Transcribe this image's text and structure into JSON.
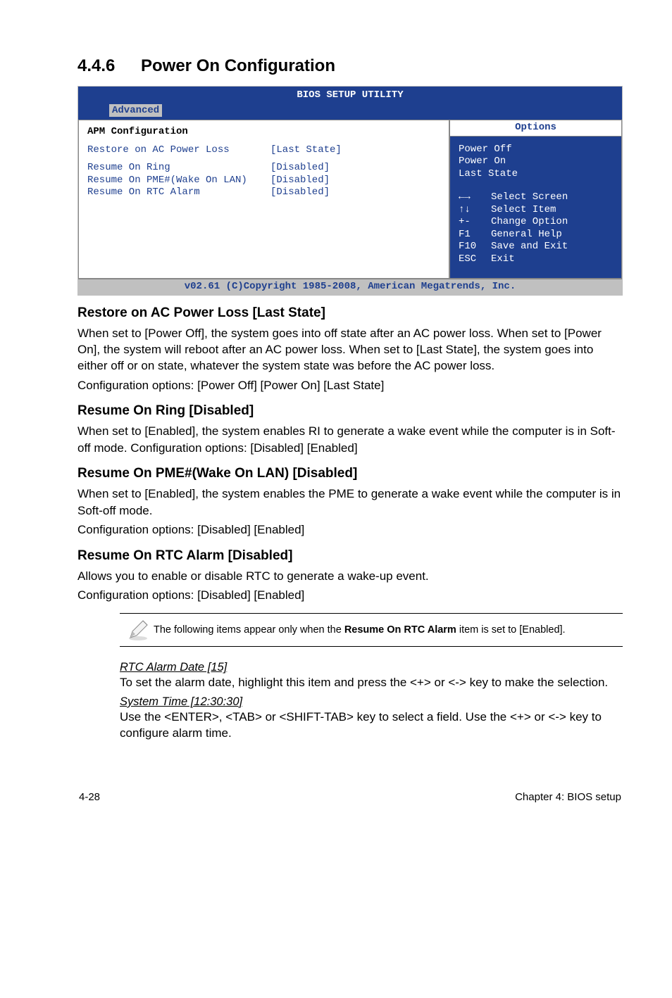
{
  "section": {
    "number": "4.4.6",
    "title": "Power On Configuration"
  },
  "bios": {
    "title": "BIOS SETUP UTILITY",
    "tab": "Advanced",
    "left_header": "APM Configuration",
    "rows": [
      {
        "label": "Restore on AC Power Loss",
        "value": "[Last State]"
      },
      {
        "label": "Resume On Ring",
        "value": "[Disabled]"
      },
      {
        "label": "Resume On PME#(Wake On LAN)",
        "value": "[Disabled]"
      },
      {
        "label": "Resume On RTC Alarm",
        "value": "[Disabled]"
      }
    ],
    "options_header": "Options",
    "options": [
      "Power Off",
      "Power On",
      "Last State"
    ],
    "help": [
      {
        "key": "←→",
        "text": "Select Screen"
      },
      {
        "key": "↑↓",
        "text": "Select Item"
      },
      {
        "key": "+-",
        "text": "Change Option"
      },
      {
        "key": "F1",
        "text": "General Help"
      },
      {
        "key": "F10",
        "text": "Save and Exit"
      },
      {
        "key": "ESC",
        "text": "Exit"
      }
    ],
    "footer": "v02.61 (C)Copyright 1985-2008, American Megatrends, Inc."
  },
  "sub1": {
    "heading": "Restore on AC Power Loss [Last State]",
    "p1": "When set to [Power Off], the system goes into off state after an AC power loss. When set to [Power On], the system will reboot after an AC power loss. When set to [Last State], the system goes into either off or on state, whatever the system state was before the AC power loss.",
    "p2": "Configuration options: [Power Off] [Power On] [Last State]"
  },
  "sub2": {
    "heading": "Resume On Ring [Disabled]",
    "p1": "When set to [Enabled], the system enables RI to generate a wake event while the computer is in Soft-off mode. Configuration options: [Disabled] [Enabled]"
  },
  "sub3": {
    "heading": "Resume On PME#(Wake On LAN) [Disabled]",
    "p1": "When set to [Enabled], the system enables the PME to generate a wake event while the computer is in Soft-off mode.",
    "p2": "Configuration options: [Disabled] [Enabled]"
  },
  "sub4": {
    "heading": "Resume On RTC Alarm [Disabled]",
    "p1": "Allows you to enable or disable RTC to generate a wake-up event.",
    "p2": "Configuration options: [Disabled] [Enabled]"
  },
  "note": {
    "pre": "The following items appear only when the ",
    "bold": "Resume On RTC Alarm",
    "post": " item is set to [Enabled]."
  },
  "rtc1": {
    "heading": "RTC Alarm Date [15]",
    "p": "To set the alarm date, highlight this item and press the <+> or <-> key to make the selection."
  },
  "rtc2": {
    "heading": "System Time [12:30:30]",
    "p": "Use the <ENTER>, <TAB> or <SHIFT-TAB> key to select a field. Use the <+> or <-> key to configure alarm time."
  },
  "footer": {
    "left": "4-28",
    "right": "Chapter 4: BIOS setup"
  }
}
